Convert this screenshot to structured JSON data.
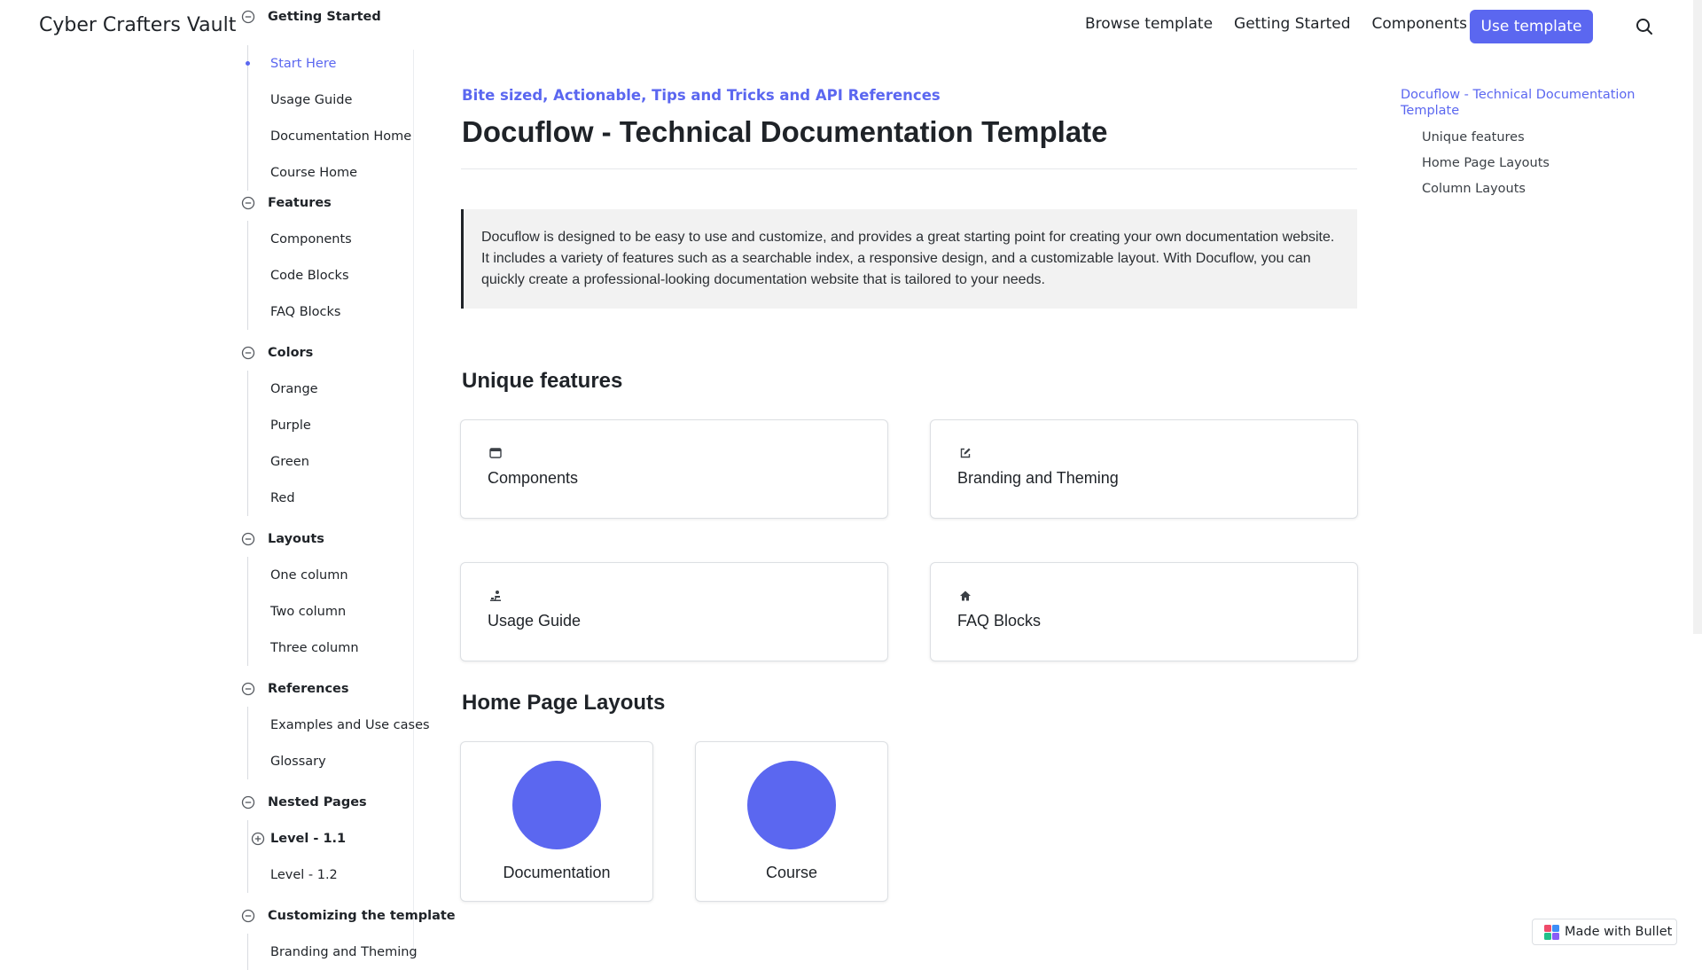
{
  "header": {
    "brand": "Cyber Crafters Vault",
    "nav": [
      "Browse template",
      "Getting Started",
      "Components"
    ],
    "cta": "Use template",
    "search_icon": "search-icon",
    "accent": "#5b67f0"
  },
  "sidebar": {
    "groups": [
      {
        "title": "Getting Started",
        "items": [
          "Start Here",
          "Usage Guide",
          "Documentation Home",
          "Course Home"
        ],
        "active": "Start Here"
      },
      {
        "title": "Features",
        "items": [
          "Components",
          "Code Blocks",
          "FAQ Blocks"
        ]
      },
      {
        "title": "Colors",
        "items": [
          "Orange",
          "Purple",
          "Green",
          "Red"
        ]
      },
      {
        "title": "Layouts",
        "items": [
          "One column",
          "Two column",
          "Three column"
        ]
      },
      {
        "title": "References",
        "items": [
          "Examples and Use cases",
          "Glossary"
        ]
      },
      {
        "title": "Nested Pages",
        "items": [
          "Level - 1.1",
          "Level - 1.2"
        ]
      },
      {
        "title": "Customizing the template",
        "items": [
          "Branding and Theming"
        ]
      }
    ]
  },
  "main": {
    "subtitle": "Bite sized, Actionable, Tips and Tricks and API References",
    "title": "Docuflow - Technical Documentation Template",
    "callout": "Docuflow is designed to be easy to use and customize, and provides a great starting point for creating your own documentation website. It includes a variety of features such as a searchable index, a responsive design, and a customizable layout. With Docuflow, you can quickly create a professional-looking documentation website that is tailored to your needs.",
    "unique_features_heading": "Unique features",
    "features": [
      {
        "title": "Components",
        "icon": "browser-window-icon"
      },
      {
        "title": "Branding and Theming",
        "icon": "edit-square-icon"
      },
      {
        "title": "Usage Guide",
        "icon": "person-at-desk-icon"
      },
      {
        "title": "FAQ Blocks",
        "icon": "home-icon"
      }
    ],
    "home_layouts_heading": "Home Page Layouts",
    "layouts": [
      "Documentation",
      "Course"
    ]
  },
  "toc": {
    "active": "Docuflow - Technical Documentation Template",
    "items": [
      "Unique features",
      "Home Page Layouts",
      "Column Layouts"
    ]
  },
  "badge": {
    "label": "Made with Bullet"
  }
}
